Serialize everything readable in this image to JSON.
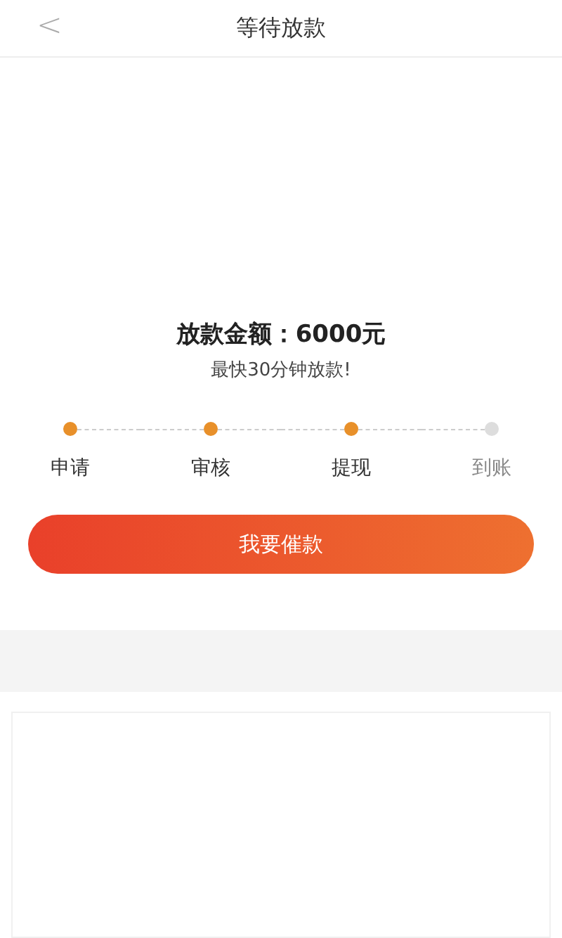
{
  "header": {
    "back": "<",
    "title": "等待放款"
  },
  "amount": {
    "label": "放款金额：",
    "value": "6000元"
  },
  "note": "最快30分钟放款!",
  "steps": [
    {
      "label": "申请",
      "done": true
    },
    {
      "label": "审核",
      "done": true
    },
    {
      "label": "提现",
      "done": true
    },
    {
      "label": "到账",
      "done": false
    }
  ],
  "button": "我要催款"
}
